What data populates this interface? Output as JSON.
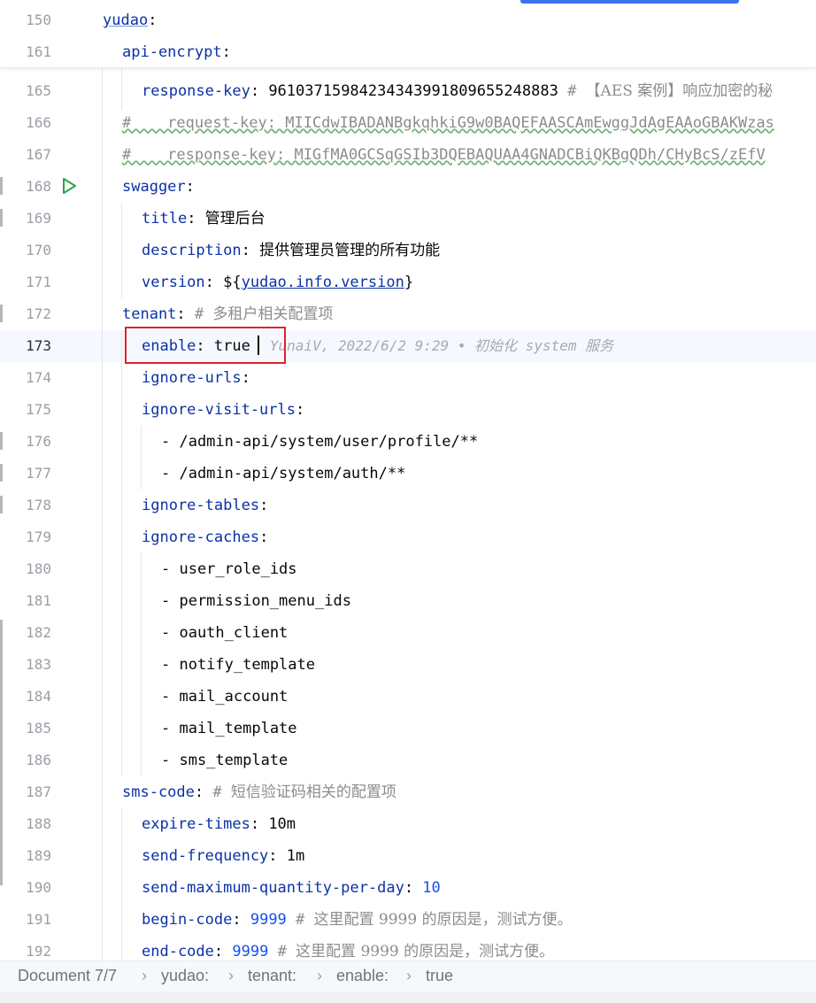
{
  "sticky": [
    {
      "num": "150",
      "indent": 0,
      "parts": [
        {
          "t": "yudao",
          "c": "k u"
        },
        {
          "t": ":",
          "c": "p"
        }
      ]
    },
    {
      "num": "161",
      "indent": 2,
      "parts": [
        {
          "t": "api-encrypt",
          "c": "k"
        },
        {
          "t": ":",
          "c": "p"
        }
      ]
    }
  ],
  "lines": [
    {
      "num": "165",
      "indent": 4,
      "parts": [
        {
          "t": "response-key",
          "c": "k"
        },
        {
          "t": ": ",
          "c": "p"
        },
        {
          "t": "96103715984234343991809655248883",
          "c": "v"
        },
        {
          "t": " # ",
          "c": "cm"
        },
        {
          "t": "【AES 案例】响应加密的秘",
          "c": "c"
        }
      ]
    },
    {
      "num": "166",
      "indent": 2,
      "parts": [
        {
          "t": "#    request-key: MIICdwIBADANBgkqhkiG9w0BAQEFAASCAmEwggJdAgEAAoGBAKWzas",
          "c": "cm w"
        }
      ]
    },
    {
      "num": "167",
      "indent": 2,
      "parts": [
        {
          "t": "#    response-key: MIGfMA0GCSqGSIb3DQEBAQUAA4GNADCBiQKBgQDh/CHyBcS/zEfV",
          "c": "cm w"
        }
      ]
    },
    {
      "num": "168",
      "indent": 2,
      "parts": [
        {
          "t": "swagger",
          "c": "k"
        },
        {
          "t": ":",
          "c": "p"
        }
      ]
    },
    {
      "num": "169",
      "indent": 4,
      "parts": [
        {
          "t": "title",
          "c": "k"
        },
        {
          "t": ": ",
          "c": "p"
        },
        {
          "t": "管理后台",
          "c": "v"
        }
      ]
    },
    {
      "num": "170",
      "indent": 4,
      "parts": [
        {
          "t": "description",
          "c": "k"
        },
        {
          "t": ": ",
          "c": "p"
        },
        {
          "t": "提供管理员管理的所有功能",
          "c": "v"
        }
      ]
    },
    {
      "num": "171",
      "indent": 4,
      "parts": [
        {
          "t": "version",
          "c": "k"
        },
        {
          "t": ": ${",
          "c": "p"
        },
        {
          "t": "yudao.info.version",
          "c": "ref"
        },
        {
          "t": "}",
          "c": "p"
        }
      ]
    },
    {
      "num": "172",
      "indent": 2,
      "parts": [
        {
          "t": "tenant",
          "c": "k"
        },
        {
          "t": ": ",
          "c": "p"
        },
        {
          "t": "# ",
          "c": "cm"
        },
        {
          "t": "多租户相关配置项",
          "c": "c"
        }
      ]
    },
    {
      "num": "173",
      "indent": 4,
      "current": true,
      "parts": [
        {
          "t": "enable",
          "c": "k"
        },
        {
          "t": ": ",
          "c": "p"
        },
        {
          "t": "true",
          "c": "v"
        }
      ],
      "blame": "YunaiV, 2022/6/2 9:29 • 初始化 system 服务"
    },
    {
      "num": "174",
      "indent": 4,
      "parts": [
        {
          "t": "ignore-urls",
          "c": "k"
        },
        {
          "t": ":",
          "c": "p"
        }
      ]
    },
    {
      "num": "175",
      "indent": 4,
      "parts": [
        {
          "t": "ignore-visit-urls",
          "c": "k"
        },
        {
          "t": ":",
          "c": "p"
        }
      ]
    },
    {
      "num": "176",
      "indent": 6,
      "parts": [
        {
          "t": "- /admin-api/system/user/profile/**",
          "c": "v"
        }
      ]
    },
    {
      "num": "177",
      "indent": 6,
      "parts": [
        {
          "t": "- /admin-api/system/auth/**",
          "c": "v"
        }
      ]
    },
    {
      "num": "178",
      "indent": 4,
      "parts": [
        {
          "t": "ignore-tables",
          "c": "k"
        },
        {
          "t": ":",
          "c": "p"
        }
      ]
    },
    {
      "num": "179",
      "indent": 4,
      "parts": [
        {
          "t": "ignore-caches",
          "c": "k"
        },
        {
          "t": ":",
          "c": "p"
        }
      ]
    },
    {
      "num": "180",
      "indent": 6,
      "parts": [
        {
          "t": "- user_role_ids",
          "c": "v"
        }
      ]
    },
    {
      "num": "181",
      "indent": 6,
      "parts": [
        {
          "t": "- permission_menu_ids",
          "c": "v"
        }
      ]
    },
    {
      "num": "182",
      "indent": 6,
      "parts": [
        {
          "t": "- oauth_client",
          "c": "v"
        }
      ]
    },
    {
      "num": "183",
      "indent": 6,
      "parts": [
        {
          "t": "- notify_template",
          "c": "v"
        }
      ]
    },
    {
      "num": "184",
      "indent": 6,
      "parts": [
        {
          "t": "- mail_account",
          "c": "v"
        }
      ]
    },
    {
      "num": "185",
      "indent": 6,
      "parts": [
        {
          "t": "- mail_template",
          "c": "v"
        }
      ]
    },
    {
      "num": "186",
      "indent": 6,
      "parts": [
        {
          "t": "- sms_template",
          "c": "v"
        }
      ]
    },
    {
      "num": "187",
      "indent": 2,
      "parts": [
        {
          "t": "sms-code",
          "c": "k"
        },
        {
          "t": ": ",
          "c": "p"
        },
        {
          "t": "# ",
          "c": "cm"
        },
        {
          "t": "短信验证码相关的配置项",
          "c": "c"
        }
      ]
    },
    {
      "num": "188",
      "indent": 4,
      "parts": [
        {
          "t": "expire-times",
          "c": "k"
        },
        {
          "t": ": ",
          "c": "p"
        },
        {
          "t": "10m",
          "c": "v"
        }
      ]
    },
    {
      "num": "189",
      "indent": 4,
      "parts": [
        {
          "t": "send-frequency",
          "c": "k"
        },
        {
          "t": ": ",
          "c": "p"
        },
        {
          "t": "1m",
          "c": "v"
        }
      ]
    },
    {
      "num": "190",
      "indent": 4,
      "parts": [
        {
          "t": "send-maximum-quantity-per-day",
          "c": "k"
        },
        {
          "t": ": ",
          "c": "p"
        },
        {
          "t": "10",
          "c": "n"
        }
      ]
    },
    {
      "num": "191",
      "indent": 4,
      "parts": [
        {
          "t": "begin-code",
          "c": "k"
        },
        {
          "t": ": ",
          "c": "p"
        },
        {
          "t": "9999",
          "c": "n"
        },
        {
          "t": " # ",
          "c": "cm"
        },
        {
          "t": "这里配置 9999 的原因是，测试方便。",
          "c": "c"
        }
      ]
    },
    {
      "num": "192",
      "indent": 4,
      "parts": [
        {
          "t": "end-code",
          "c": "k"
        },
        {
          "t": ": ",
          "c": "p"
        },
        {
          "t": "9999",
          "c": "n"
        },
        {
          "t": " # ",
          "c": "cm"
        },
        {
          "t": "这里配置 9999 的原因是，测试方便。",
          "c": "c"
        }
      ]
    }
  ],
  "breadcrumbs": [
    "Document 7/7",
    "yudao:",
    "tenant:",
    "enable:",
    "true"
  ],
  "colors": {
    "key": "#0b32a6",
    "number": "#1750eb",
    "comment": "#8c8c8c",
    "highlight_box": "#e0222b",
    "run_icon": "#2aa344"
  }
}
